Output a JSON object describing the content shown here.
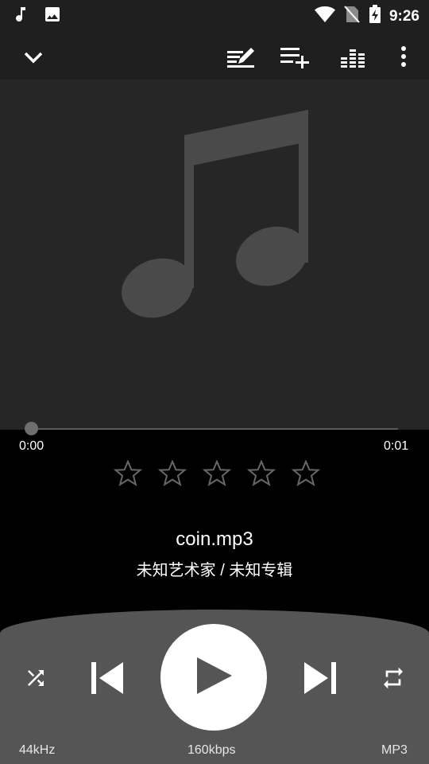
{
  "status_bar": {
    "time": "9:26",
    "left_icons": [
      "music-note-icon",
      "image-icon"
    ],
    "right_icons": [
      "wifi-icon",
      "no-sim-icon",
      "battery-charging-icon"
    ]
  },
  "toolbar": {
    "icons": [
      "chevron-down-icon",
      "edit-tags-icon",
      "add-to-playlist-icon",
      "equalizer-icon",
      "more-vert-icon"
    ]
  },
  "player": {
    "elapsed": "0:00",
    "duration": "0:01",
    "progress": 0.0,
    "rating_max": 5,
    "rating_value": 0,
    "title": "coin.mp3",
    "subtitle": "未知艺术家 / 未知专辑"
  },
  "footer": {
    "sample_rate": "44kHz",
    "bitrate": "160kbps",
    "format": "MP3"
  },
  "colors": {
    "background": "#1f1f1f",
    "art_background": "#262626",
    "controls_panel": "#555555",
    "accent": "#ffffff"
  }
}
